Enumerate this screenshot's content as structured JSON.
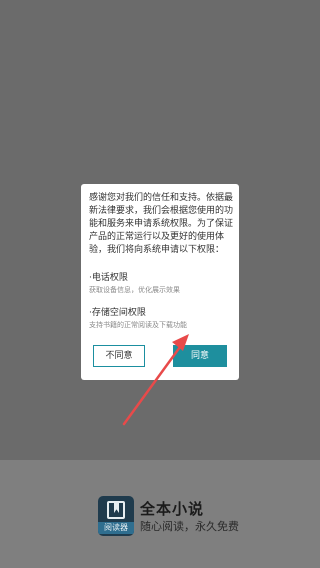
{
  "dialog": {
    "body": "感谢您对我们的信任和支持。依据最新法律要求，我们会根据您使用的功能和服务来申请系统权限。为了保证产品的正常运行以及更好的使用体验，我们将向系统申请以下权限：",
    "permissions": [
      {
        "title": "·电话权限",
        "desc": "获取设备信息，优化展示效果"
      },
      {
        "title": "·存储空间权限",
        "desc": "支持书籍的正常阅读及下载功能"
      }
    ],
    "deny_label": "不同意",
    "agree_label": "同意"
  },
  "splash": {
    "logo_caption": "阅读器",
    "app_name": "全本小说",
    "slogan": "随心阅读，永久免费"
  },
  "colors": {
    "accent": "#1e8f9e",
    "arrow": "#e84a4a"
  }
}
